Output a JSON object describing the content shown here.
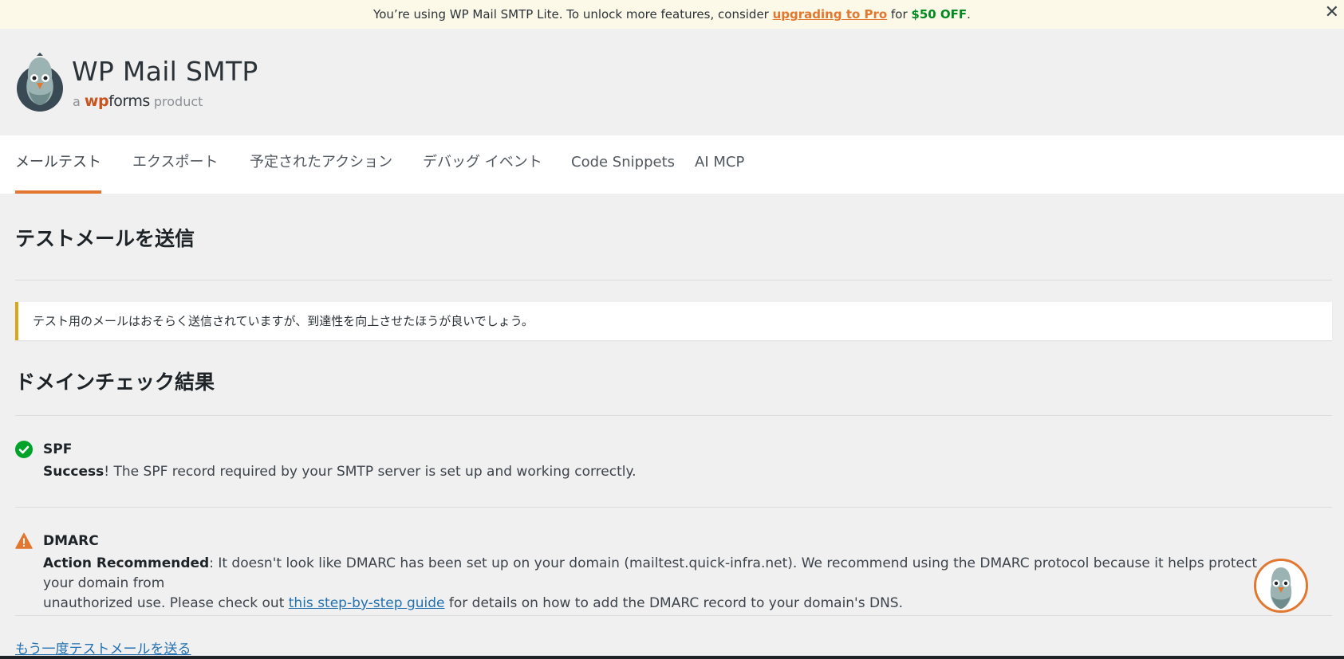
{
  "promo": {
    "text_before": "You’re using WP Mail SMTP Lite. To unlock more features, consider ",
    "link": "upgrading to Pro",
    "text_middle": " for ",
    "discount": "$50 OFF",
    "text_after": ".",
    "close": "✕"
  },
  "brand": {
    "title": "WP Mail SMTP",
    "sub_a": "a",
    "sub_wp": "wp",
    "sub_forms": "forms",
    "sub_product": "product"
  },
  "tabs": [
    {
      "label": "メールテスト",
      "active": true
    },
    {
      "label": "エクスポート"
    },
    {
      "label": "予定されたアクション"
    },
    {
      "label": "デバッグ イベント"
    },
    {
      "label": "Code Snippets"
    },
    {
      "label": "AI MCP"
    }
  ],
  "main": {
    "title": "テストメールを送信",
    "notice": "テスト用のメールはおそらく送信されていますが、到達性を向上させたほうが良いでしょう。",
    "domain_title": "ドメインチェック結果",
    "checks": [
      {
        "status": "success",
        "icon": "check-circle-icon",
        "title": "SPF",
        "strong": "Success",
        "text": "! The SPF record required by your SMTP server is set up and working correctly."
      },
      {
        "status": "warning",
        "icon": "warning-triangle-icon",
        "title": "DMARC",
        "strong": "Action Recommended",
        "text_line1": ": It doesn't look like DMARC has been set up on your domain (mailtest.quick-infra.net). We recommend using the DMARC protocol because it helps protect your domain from",
        "text_line2_before": "unauthorized use. Please check out ",
        "link": "this step-by-step guide",
        "text_line2_after": " for details on how to add the DMARC record to your domain's DNS."
      }
    ],
    "resend": "もう一度テストメールを送る"
  },
  "colors": {
    "accent": "#e27730",
    "success": "#00a32a",
    "warning": "#dba617",
    "link": "#2271b1"
  }
}
